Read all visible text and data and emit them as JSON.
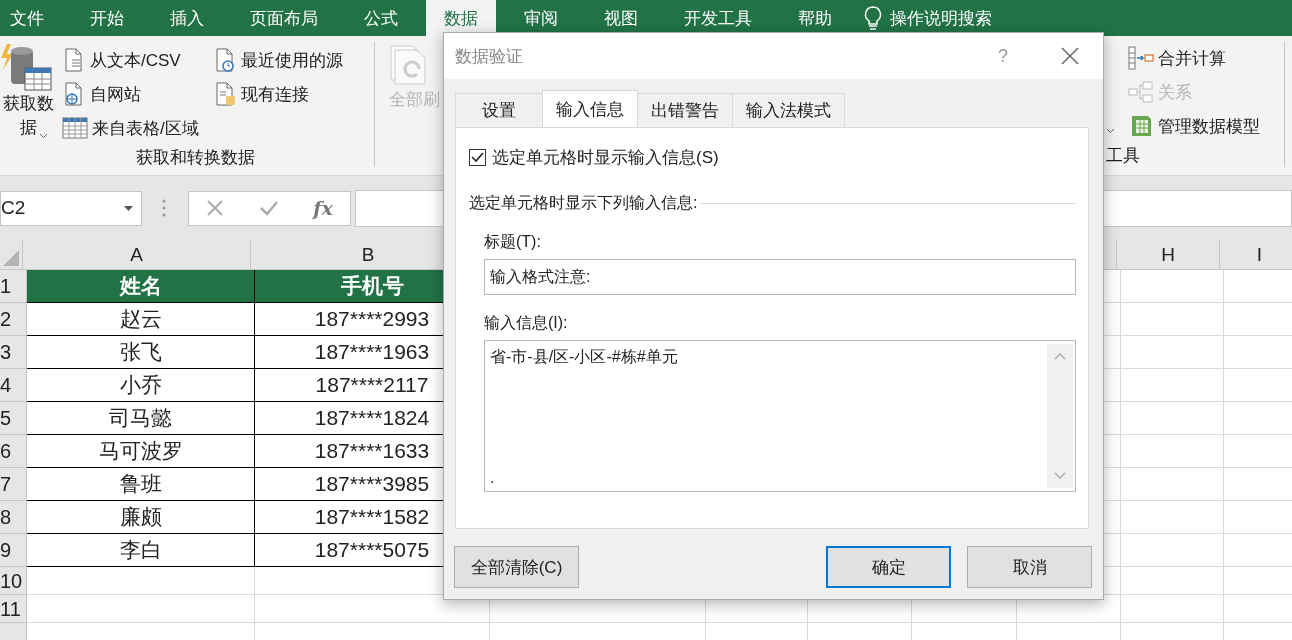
{
  "ribbon_tabs": [
    {
      "label": "文件",
      "selected": false
    },
    {
      "label": "开始",
      "selected": false
    },
    {
      "label": "插入",
      "selected": false
    },
    {
      "label": "页面布局",
      "selected": false
    },
    {
      "label": "公式",
      "selected": false
    },
    {
      "label": "数据",
      "selected": true
    },
    {
      "label": "审阅",
      "selected": false
    },
    {
      "label": "视图",
      "selected": false
    },
    {
      "label": "开发工具",
      "selected": false
    },
    {
      "label": "帮助",
      "selected": false
    }
  ],
  "tell_me": "操作说明搜索",
  "get_transform_group": {
    "big_button": "获取数据",
    "items": [
      {
        "label": "从文本/CSV",
        "disabled": false
      },
      {
        "label": "自网站",
        "disabled": false
      },
      {
        "label": "来自表格/区域",
        "disabled": false
      },
      {
        "label": "最近使用的源",
        "disabled": false
      },
      {
        "label": "现有连接",
        "disabled": false
      }
    ],
    "group_label": "获取和转换数据"
  },
  "refresh_button": {
    "label": "全部刷",
    "disabled": true
  },
  "data_tools_group": {
    "group_label": "工具",
    "items": [
      {
        "label": "合并计算",
        "disabled": false
      },
      {
        "label": "关系",
        "disabled": true
      },
      {
        "label": "管理数据模型",
        "disabled": false
      }
    ]
  },
  "formula_bar": {
    "name_box": "C2",
    "function_label": "fx"
  },
  "sheet": {
    "columns": [
      "A",
      "B",
      "",
      "",
      "",
      "",
      "",
      "H",
      "I"
    ],
    "rows": [
      {
        "header": "1",
        "cells": [
          "姓名",
          "手机号"
        ],
        "kind": "heading"
      },
      {
        "header": "2",
        "cells": [
          "赵云",
          "187****2993"
        ],
        "kind": "data"
      },
      {
        "header": "3",
        "cells": [
          "张飞",
          "187****1963"
        ],
        "kind": "data"
      },
      {
        "header": "4",
        "cells": [
          "小乔",
          "187****2117"
        ],
        "kind": "data"
      },
      {
        "header": "5",
        "cells": [
          "司马懿",
          "187****1824"
        ],
        "kind": "data"
      },
      {
        "header": "6",
        "cells": [
          "马可波罗",
          "187****1633"
        ],
        "kind": "data"
      },
      {
        "header": "7",
        "cells": [
          "鲁班",
          "187****3985"
        ],
        "kind": "data"
      },
      {
        "header": "8",
        "cells": [
          "廉颇",
          "187****1582"
        ],
        "kind": "data"
      },
      {
        "header": "9",
        "cells": [
          "李白",
          "187****5075"
        ],
        "kind": "data"
      },
      {
        "header": "10",
        "cells": [],
        "kind": "empty"
      },
      {
        "header": "11",
        "cells": [],
        "kind": "empty"
      },
      {
        "header": "",
        "cells": [],
        "kind": "empty"
      }
    ]
  },
  "dialog": {
    "title": "数据验证",
    "help": "?",
    "tabs": [
      {
        "label": "设置",
        "selected": false
      },
      {
        "label": "输入信息",
        "selected": true
      },
      {
        "label": "出错警告",
        "selected": false
      },
      {
        "label": "输入法模式",
        "selected": false
      }
    ],
    "show_checkbox": {
      "label": "选定单元格时显示输入信息(S)",
      "checked": true
    },
    "section_label": "选定单元格时显示下列输入信息:",
    "title_label": "标题(T):",
    "title_value": "输入格式注意:",
    "message_label": "输入信息(I):",
    "message_lines": [
      "省-市-县/区-小区-#栋#单元",
      "."
    ],
    "buttons": [
      {
        "label": "全部清除(C)",
        "default": false
      },
      {
        "label": "确定",
        "default": true
      },
      {
        "label": "取消",
        "default": false
      }
    ]
  }
}
